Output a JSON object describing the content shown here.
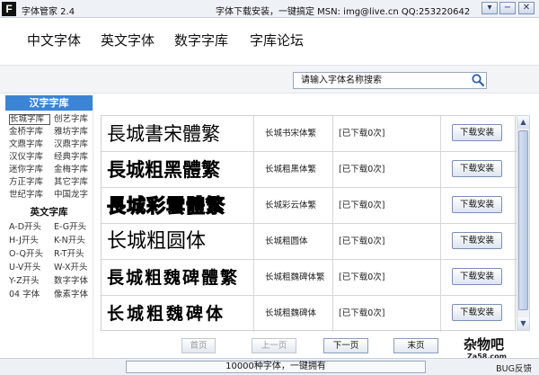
{
  "titlebar": {
    "app_title": "字体管家 2.4",
    "tagline": "字体下载安装，一键搞定 MSN: img@live.cn  QQ:253220642",
    "controls": [
      "▾",
      "−",
      "✕"
    ]
  },
  "nav": [
    "中文字体",
    "英文字体",
    "数字字库",
    "字库论坛"
  ],
  "search": {
    "placeholder": "请输入字体名称搜索"
  },
  "sidebar": {
    "header": "汉字字库",
    "cn_items": [
      "长城字库",
      "创艺字库",
      "金桥字库",
      "雅坊字库",
      "文鼎字库",
      "汉鼎字库",
      "汉仪字库",
      "经典字库",
      "迷你字库",
      "金梅字库",
      "方正字库",
      "其它字库",
      "世纪字库",
      "中国龙字"
    ],
    "en_header": "英文字库",
    "en_items": [
      "A-D开头",
      "E-G开头",
      "H-J开头",
      "K-N开头",
      "O-Q开头",
      "R-T开头",
      "U-V开头",
      "W-X开头",
      "Y-Z开头",
      "数字字体",
      "04 字体",
      "像素字体"
    ]
  },
  "fonts": [
    {
      "preview": "長城書宋體繁",
      "name": "长城书宋体繁",
      "status": "[已下载0次]",
      "button": "下载安装"
    },
    {
      "preview": "長城粗黑體繁",
      "name": "长城粗黑体繁",
      "status": "[已下载0次]",
      "button": "下载安装"
    },
    {
      "preview": "長城彩雲體繁",
      "name": "长城彩云体繁",
      "status": "[已下载0次]",
      "button": "下载安装"
    },
    {
      "preview": "长城粗圆体",
      "name": "长城粗圆体",
      "status": "[已下载0次]",
      "button": "下载安装"
    },
    {
      "preview": "長城粗魏碑體繁",
      "name": "长城粗魏碑体繁",
      "status": "[已下载0次]",
      "button": "下载安装"
    },
    {
      "preview": "长城粗魏碑体",
      "name": "长城粗魏碑体",
      "status": "[已下载0次]",
      "button": "下载安装"
    }
  ],
  "pager": {
    "first": "首页",
    "prev": "上一页",
    "next": "下一页",
    "last": "末页"
  },
  "watermark": {
    "main": "杂物吧",
    "sub": "Za58.com"
  },
  "status": {
    "text": "10000种字体，一键拥有",
    "bug": "BUG反馈"
  }
}
